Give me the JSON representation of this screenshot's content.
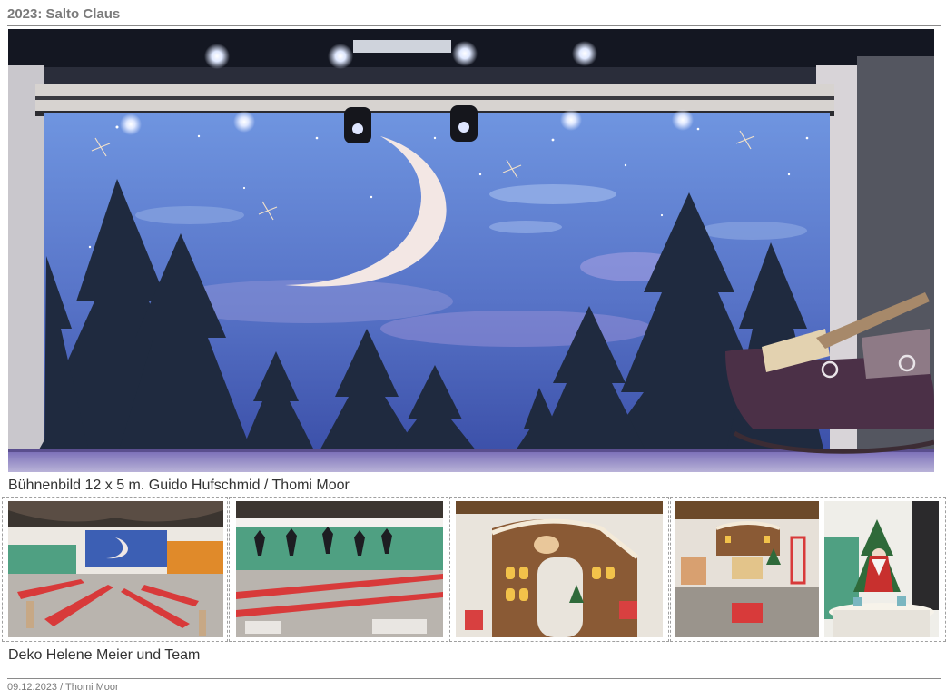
{
  "page": {
    "title": "2023: Salto Claus",
    "stage_caption": "Bühnenbild 12 x 5 m.  Guido Hufschmid / Thomi Moor",
    "deco_caption": "Deko Helene Meier und Team",
    "footer": "09.12.2023 / Thomi Moor"
  },
  "photos": {
    "hero": "stage-backdrop-photo",
    "gallery": [
      "hall-overview-photo",
      "hall-tables-photo",
      "gingerbread-gate-photo",
      "gingerbread-corridor-photo",
      "santa-table-photo"
    ]
  },
  "colors": {
    "title_text": "#7a7a7a",
    "sky_top": "#6f95e0",
    "sky_bottom": "#3b4fa8",
    "tree": "#1f2a3f",
    "green_wall": "#4fa082",
    "gingerbread": "#8a5a35"
  }
}
